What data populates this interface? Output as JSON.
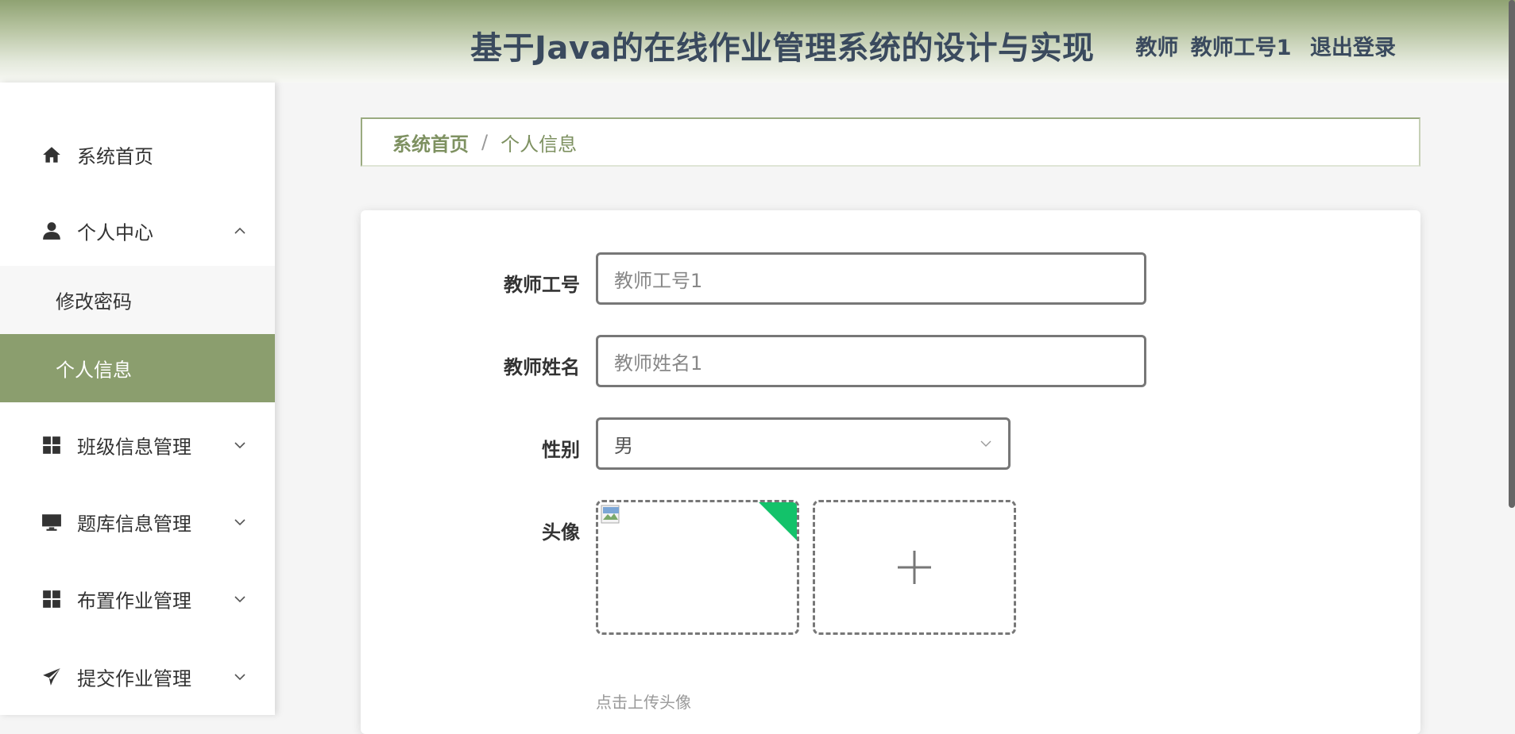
{
  "header": {
    "title": "基于Java的在线作业管理系统的设计与实现",
    "user_role": "教师",
    "user_name": "教师工号1",
    "logout_label": "退出登录"
  },
  "sidebar": {
    "items": [
      {
        "label": "系统首页",
        "icon": "home-icon"
      },
      {
        "label": "个人中心",
        "icon": "user-icon",
        "expanded": true,
        "children": [
          {
            "label": "修改密码",
            "active": false
          },
          {
            "label": "个人信息",
            "active": true
          }
        ]
      },
      {
        "label": "班级信息管理",
        "icon": "grid-icon"
      },
      {
        "label": "题库信息管理",
        "icon": "monitor-icon"
      },
      {
        "label": "布置作业管理",
        "icon": "grid-icon"
      },
      {
        "label": "提交作业管理",
        "icon": "send-icon"
      }
    ]
  },
  "breadcrumb": {
    "home": "系统首页",
    "separator": "/",
    "current": "个人信息"
  },
  "form": {
    "teacher_id": {
      "label": "教师工号",
      "value": "教师工号1"
    },
    "teacher_name": {
      "label": "教师姓名",
      "value": "教师姓名1"
    },
    "gender": {
      "label": "性别",
      "value": "男"
    },
    "avatar": {
      "label": "头像",
      "hint": "点击上传头像"
    }
  },
  "colors": {
    "accent": "#8b9e6e",
    "header_text": "#3a4a5e",
    "upload_badge": "#13c26a"
  }
}
